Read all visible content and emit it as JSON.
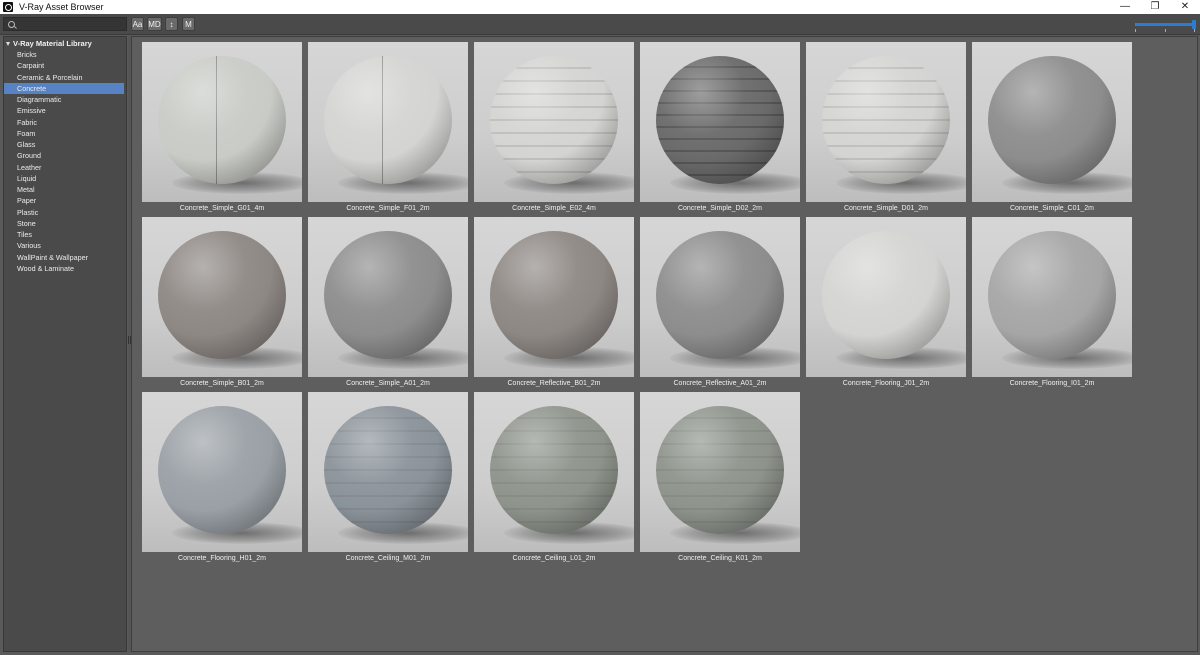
{
  "window": {
    "title": "V-Ray Asset Browser",
    "controls": {
      "minimize": "—",
      "restore": "❐",
      "close": "✕"
    }
  },
  "toolbar": {
    "search": {
      "value": "",
      "placeholder": ""
    },
    "buttons": [
      "Aa",
      "MD",
      "↕",
      "M"
    ],
    "thumbnail_size": 1.0
  },
  "sidebar": {
    "root_label": "V-Ray Material Library",
    "selected": "Concrete",
    "items": [
      "Bricks",
      "Carpaint",
      "Ceramic & Porcelain",
      "Concrete",
      "Diagrammatic",
      "Emissive",
      "Fabric",
      "Foam",
      "Glass",
      "Ground",
      "Leather",
      "Liquid",
      "Metal",
      "Paper",
      "Plastic",
      "Stone",
      "Tiles",
      "Various",
      "WallPaint & Wallpaper",
      "Wood & Laminate"
    ]
  },
  "materials": [
    {
      "name": "Concrete_Simple_G01_4m",
      "tone": "light",
      "pattern": "seam"
    },
    {
      "name": "Concrete_Simple_F01_2m",
      "tone": "light2",
      "pattern": "seam"
    },
    {
      "name": "Concrete_Simple_E02_4m",
      "tone": "light2",
      "pattern": "lines-light"
    },
    {
      "name": "Concrete_Simple_D02_2m",
      "tone": "dark",
      "pattern": "lines"
    },
    {
      "name": "Concrete_Simple_D01_2m",
      "tone": "light2",
      "pattern": "lines-light"
    },
    {
      "name": "Concrete_Simple_C01_2m",
      "tone": "grey",
      "pattern": "none"
    },
    {
      "name": "Concrete_Simple_B01_2m",
      "tone": "warm",
      "pattern": "none"
    },
    {
      "name": "Concrete_Simple_A01_2m",
      "tone": "grey",
      "pattern": "none"
    },
    {
      "name": "Concrete_Reflective_B01_2m",
      "tone": "warm",
      "pattern": "none"
    },
    {
      "name": "Concrete_Reflective_A01_2m",
      "tone": "grey",
      "pattern": "none"
    },
    {
      "name": "Concrete_Flooring_J01_2m",
      "tone": "light2",
      "pattern": "none"
    },
    {
      "name": "Concrete_Flooring_I01_2m",
      "tone": "mid",
      "pattern": "none"
    },
    {
      "name": "Concrete_Flooring_H01_2m",
      "tone": "cool",
      "pattern": "none"
    },
    {
      "name": "Concrete_Ceiling_M01_2m",
      "tone": "cool2",
      "pattern": "lines-light"
    },
    {
      "name": "Concrete_Ceiling_L01_2m",
      "tone": "green",
      "pattern": "lines-light"
    },
    {
      "name": "Concrete_Ceiling_K01_2m",
      "tone": "green",
      "pattern": "lines-light"
    }
  ],
  "colors": {
    "selection": "#5783c4",
    "slider_accent": "#2b7cd3",
    "panel_bg": "#5e5e5e"
  }
}
